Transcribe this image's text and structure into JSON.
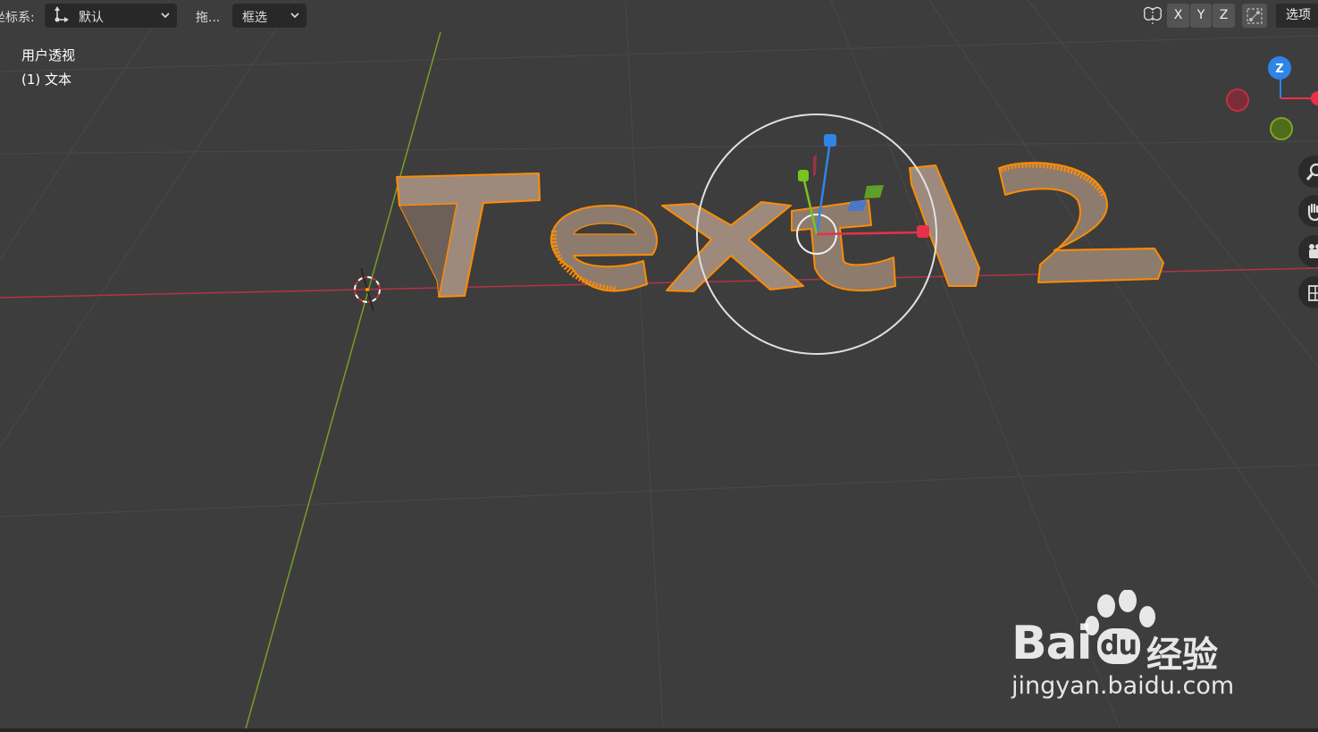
{
  "toolbar": {
    "orientation_label": "坐标系:",
    "orientation_value": "默认",
    "drag_label": "拖...",
    "select_mode_value": "框选",
    "axis_x": "X",
    "axis_y": "Y",
    "axis_z": "Z",
    "options_label": "选项"
  },
  "viewport": {
    "view_name": "用户透视",
    "object_info": "(1) 文本",
    "object_text": "Text12",
    "colors": {
      "background": "#3d3d3d",
      "x_axis": "#c2374b",
      "y_axis": "#7ba52a",
      "z_axis": "#2f84e8",
      "selection": "#ff8c00",
      "mesh_face": "#9d8b7f"
    }
  },
  "navigation_gizmo": {
    "z_label": "Z"
  },
  "watermark": {
    "brand": "Bai",
    "brand2": "经验",
    "url": "jingyan.baidu.com"
  }
}
